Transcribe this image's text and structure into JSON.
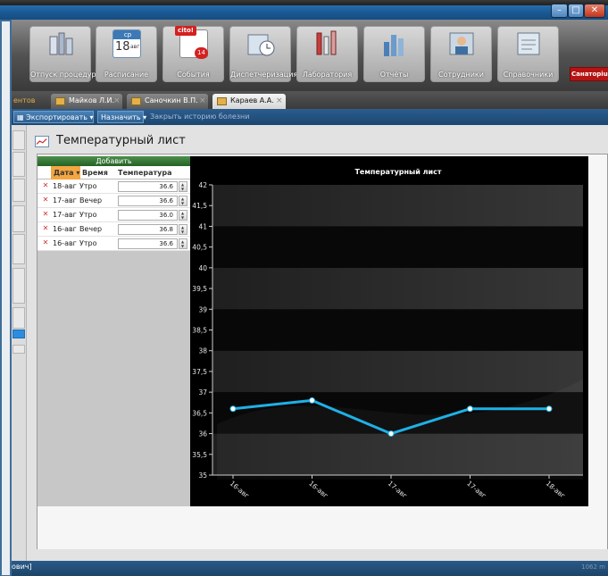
{
  "ribbon": {
    "buttons": [
      {
        "label": "Отпуск процедур",
        "icon": "bottles-icon"
      },
      {
        "label": "Расписание",
        "icon": "calendar-icon",
        "day_of_week": "ср",
        "day_num": "18",
        "month": "авг"
      },
      {
        "label": "События",
        "icon": "notepad-icon",
        "cito": "cito!",
        "count": "14"
      },
      {
        "label": "Диспетчеризация",
        "icon": "clock-icon"
      },
      {
        "label": "Лаборатория",
        "icon": "lab-icon"
      },
      {
        "label": "Отчёты",
        "icon": "bar-chart-icon"
      },
      {
        "label": "Сотрудники",
        "icon": "staff-icon"
      },
      {
        "label": "Справочники",
        "icon": "reference-icon"
      }
    ],
    "badge": "Санаторium"
  },
  "tabs": {
    "first": "ентов",
    "items": [
      {
        "label": "Майков Л.И."
      },
      {
        "label": "Саночкин В.П."
      },
      {
        "label": "Караев А.А."
      }
    ]
  },
  "toolbar": {
    "export": "Экспортировать",
    "assign": "Назначить",
    "close_history": "Закрыть историю болезни"
  },
  "page": {
    "title": "Температурный лист"
  },
  "grid": {
    "add_label": "Добавить",
    "headers": {
      "date": "Дата",
      "time": "Время",
      "temp": "Температура"
    },
    "rows": [
      {
        "date": "18-авг",
        "time": "Утро",
        "temp": "36.6"
      },
      {
        "date": "17-авг",
        "time": "Вечер",
        "temp": "36.6"
      },
      {
        "date": "17-авг",
        "time": "Утро",
        "temp": "36.0"
      },
      {
        "date": "16-авг",
        "time": "Вечер",
        "temp": "36.8"
      },
      {
        "date": "16-авг",
        "time": "Утро",
        "temp": "36.6"
      }
    ]
  },
  "chart_data": {
    "type": "line",
    "title": "Температурный лист",
    "x": [
      "16-авг",
      "16-авг",
      "17-авг",
      "17-авг",
      "18-авг"
    ],
    "series": [
      {
        "values": [
          36.6,
          36.8,
          36.0,
          36.6,
          36.6
        ],
        "color": "#1fb0e6"
      }
    ],
    "ylim": [
      35,
      42
    ],
    "yticks": [
      "35",
      "35,5",
      "36",
      "36,5",
      "37",
      "37,5",
      "38",
      "38,5",
      "39",
      "39,5",
      "40",
      "40,5",
      "41",
      "41,5",
      "42"
    ],
    "grid": true,
    "background": "#000000"
  },
  "status": {
    "left": "ович]",
    "right": "1062 m"
  },
  "colors": {
    "accent": "#2d6aa3",
    "add_button": "#2f7a2f",
    "date_header": "#f4a642",
    "line": "#1fb0e6",
    "badge": "#b61414"
  }
}
